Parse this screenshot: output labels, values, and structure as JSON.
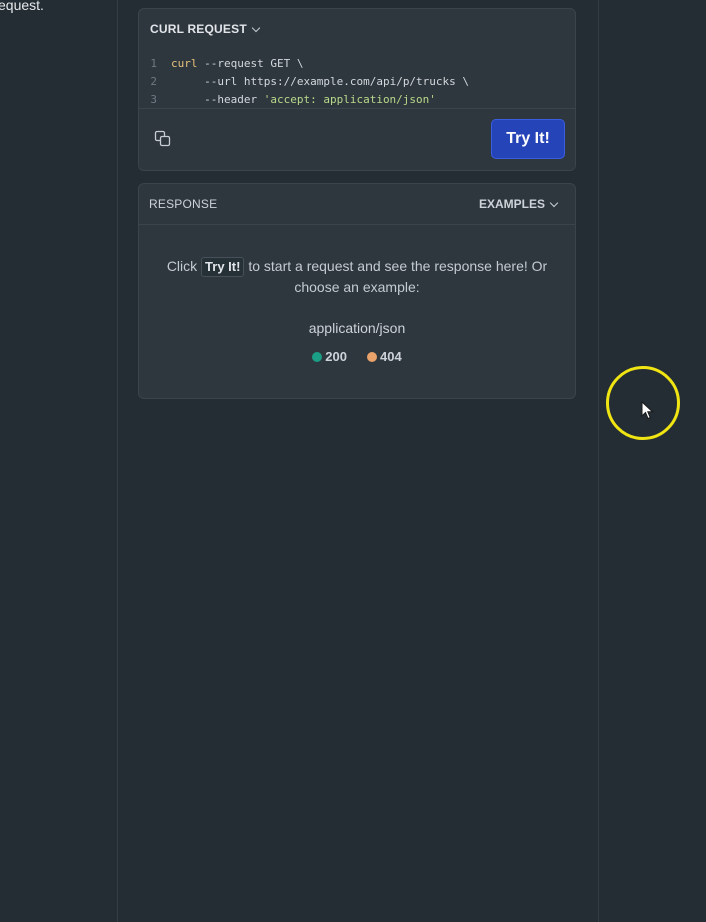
{
  "page": {
    "cut_text": "equest."
  },
  "curl": {
    "title": "CURL REQUEST",
    "lines": [
      {
        "n": "1",
        "cmd": "curl",
        "rest": " --request GET \\"
      },
      {
        "n": "2",
        "indent": "     ",
        "flag": "--url",
        "rest": " https://example.com/api/p/trucks \\"
      },
      {
        "n": "3",
        "indent": "     ",
        "flag": "--header",
        "str": " 'accept: application/json'"
      }
    ],
    "try_label": "Try It!"
  },
  "response": {
    "title": "RESPONSE",
    "examples_label": "EXAMPLES",
    "msg_before": "Click ",
    "msg_kbd": "Try It!",
    "msg_after": " to start a request and see the response here! Or choose an example:",
    "mime": "application/json",
    "codes": [
      {
        "label": "200",
        "color": "#1a9e86"
      },
      {
        "label": "404",
        "color": "#e8a26a"
      }
    ]
  }
}
